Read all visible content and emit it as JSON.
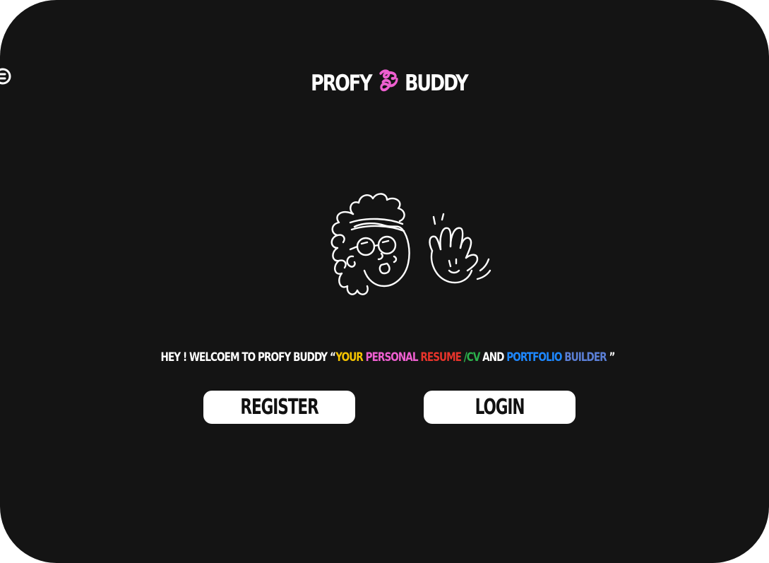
{
  "brand": {
    "name_left": "PROFY",
    "name_right": "BUDDY",
    "mark_icon": "pink-squiggle-logo-mark",
    "mark_color": "#ee5fd0"
  },
  "illustration": {
    "icon": "waving-character-illustration"
  },
  "edge_icon": {
    "icon": "partially-visible-circle-icon"
  },
  "welcome": {
    "prefix": "HEY ! WELCOEM TO PROFY BUDDY “",
    "your": "YOUR",
    "personal": "PERSONAL",
    "resume": "RESUME",
    "slash_cv": "/CV",
    "and": "AND",
    "portfolio": "PORTFOLIO",
    "builder": "BUILDER",
    "suffix": " ”",
    "colors": {
      "your": "#f5c400",
      "personal": "#ee5fd0",
      "resume": "#e8342b",
      "cv": "#2bb24c",
      "portfolio": "#1e88ff",
      "builder": "#5b7fd6"
    }
  },
  "actions": {
    "register_label": "REGISTER",
    "login_label": "LOGIN"
  },
  "theme": {
    "background": "#141414",
    "button_background": "#ffffff",
    "text": "#ffffff"
  }
}
